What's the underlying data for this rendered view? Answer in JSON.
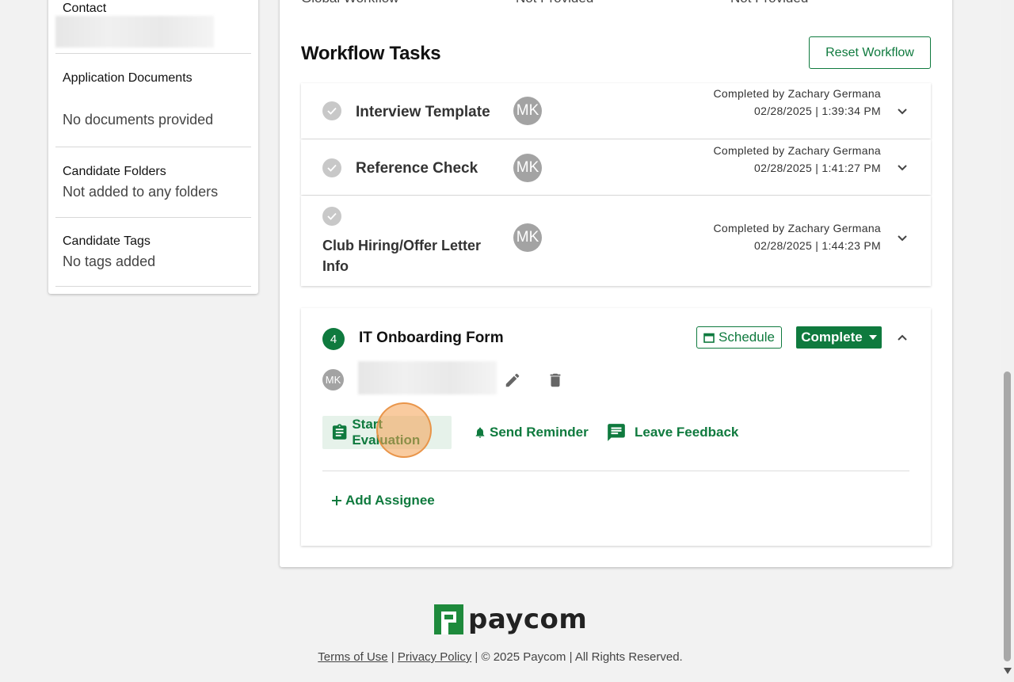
{
  "sidebar": {
    "contact_label": "Contact",
    "app_docs_label": "Application Documents",
    "app_docs_value": "No documents provided",
    "folders_label": "Candidate Folders",
    "folders_value": "Not added to any folders",
    "tags_label": "Candidate Tags",
    "tags_value": "No tags added"
  },
  "header_row": {
    "col1": "Global Workflow",
    "col2": "Not Provided",
    "col3": "Not Provided"
  },
  "workflow": {
    "title": "Workflow Tasks",
    "reset_label": "Reset Workflow",
    "tasks": [
      {
        "name": "Interview Template",
        "avatar": "MK",
        "completed_by": "Completed by Zachary Germana",
        "completed_at": "02/28/2025 | 1:39:34 PM"
      },
      {
        "name": "Reference Check",
        "avatar": "MK",
        "completed_by": "Completed by Zachary Germana",
        "completed_at": "02/28/2025 | 1:41:27 PM"
      },
      {
        "name": "Club Hiring/Offer Letter Info",
        "avatar": "MK",
        "completed_by": "Completed by Zachary Germana",
        "completed_at": "02/28/2025 | 1:44:23 PM"
      }
    ],
    "active_task": {
      "step": "4",
      "name": "IT Onboarding Form",
      "schedule_label": "Schedule",
      "complete_label": "Complete",
      "assignee_initials": "MK",
      "start_eval_label": "Start Evaluation",
      "send_reminder_label": "Send Reminder",
      "leave_feedback_label": "Leave Feedback",
      "add_assignee_label": "Add Assignee"
    }
  },
  "footer": {
    "logo_text": "paycom",
    "terms_label": "Terms of Use",
    "privacy_label": "Privacy Policy",
    "copyright": "© 2025 Paycom | All Rights Reserved."
  },
  "colors": {
    "accent": "#0f7a3e",
    "background": "#f2f2f2"
  }
}
